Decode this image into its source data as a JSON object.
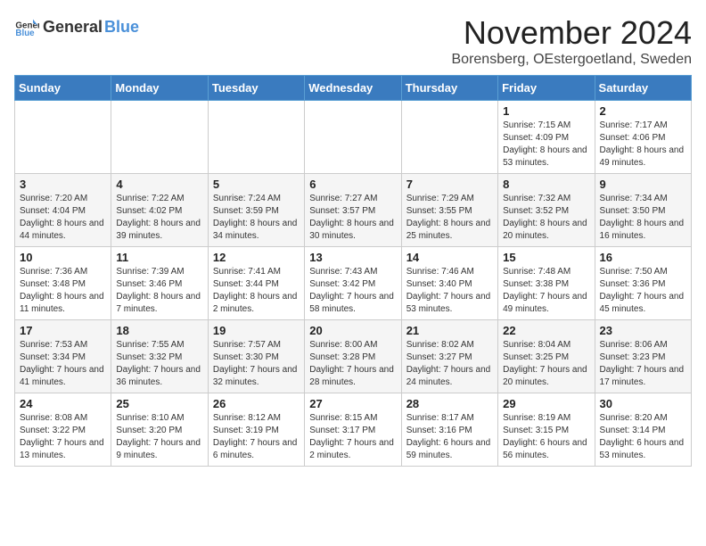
{
  "header": {
    "logo": {
      "text_general": "General",
      "text_blue": "Blue"
    },
    "title": "November 2024",
    "subtitle": "Borensberg, OEstergoetland, Sweden"
  },
  "calendar": {
    "weekdays": [
      "Sunday",
      "Monday",
      "Tuesday",
      "Wednesday",
      "Thursday",
      "Friday",
      "Saturday"
    ],
    "weeks": [
      [
        {
          "day": "",
          "info": ""
        },
        {
          "day": "",
          "info": ""
        },
        {
          "day": "",
          "info": ""
        },
        {
          "day": "",
          "info": ""
        },
        {
          "day": "",
          "info": ""
        },
        {
          "day": "1",
          "info": "Sunrise: 7:15 AM\nSunset: 4:09 PM\nDaylight: 8 hours and 53 minutes."
        },
        {
          "day": "2",
          "info": "Sunrise: 7:17 AM\nSunset: 4:06 PM\nDaylight: 8 hours and 49 minutes."
        }
      ],
      [
        {
          "day": "3",
          "info": "Sunrise: 7:20 AM\nSunset: 4:04 PM\nDaylight: 8 hours and 44 minutes."
        },
        {
          "day": "4",
          "info": "Sunrise: 7:22 AM\nSunset: 4:02 PM\nDaylight: 8 hours and 39 minutes."
        },
        {
          "day": "5",
          "info": "Sunrise: 7:24 AM\nSunset: 3:59 PM\nDaylight: 8 hours and 34 minutes."
        },
        {
          "day": "6",
          "info": "Sunrise: 7:27 AM\nSunset: 3:57 PM\nDaylight: 8 hours and 30 minutes."
        },
        {
          "day": "7",
          "info": "Sunrise: 7:29 AM\nSunset: 3:55 PM\nDaylight: 8 hours and 25 minutes."
        },
        {
          "day": "8",
          "info": "Sunrise: 7:32 AM\nSunset: 3:52 PM\nDaylight: 8 hours and 20 minutes."
        },
        {
          "day": "9",
          "info": "Sunrise: 7:34 AM\nSunset: 3:50 PM\nDaylight: 8 hours and 16 minutes."
        }
      ],
      [
        {
          "day": "10",
          "info": "Sunrise: 7:36 AM\nSunset: 3:48 PM\nDaylight: 8 hours and 11 minutes."
        },
        {
          "day": "11",
          "info": "Sunrise: 7:39 AM\nSunset: 3:46 PM\nDaylight: 8 hours and 7 minutes."
        },
        {
          "day": "12",
          "info": "Sunrise: 7:41 AM\nSunset: 3:44 PM\nDaylight: 8 hours and 2 minutes."
        },
        {
          "day": "13",
          "info": "Sunrise: 7:43 AM\nSunset: 3:42 PM\nDaylight: 7 hours and 58 minutes."
        },
        {
          "day": "14",
          "info": "Sunrise: 7:46 AM\nSunset: 3:40 PM\nDaylight: 7 hours and 53 minutes."
        },
        {
          "day": "15",
          "info": "Sunrise: 7:48 AM\nSunset: 3:38 PM\nDaylight: 7 hours and 49 minutes."
        },
        {
          "day": "16",
          "info": "Sunrise: 7:50 AM\nSunset: 3:36 PM\nDaylight: 7 hours and 45 minutes."
        }
      ],
      [
        {
          "day": "17",
          "info": "Sunrise: 7:53 AM\nSunset: 3:34 PM\nDaylight: 7 hours and 41 minutes."
        },
        {
          "day": "18",
          "info": "Sunrise: 7:55 AM\nSunset: 3:32 PM\nDaylight: 7 hours and 36 minutes."
        },
        {
          "day": "19",
          "info": "Sunrise: 7:57 AM\nSunset: 3:30 PM\nDaylight: 7 hours and 32 minutes."
        },
        {
          "day": "20",
          "info": "Sunrise: 8:00 AM\nSunset: 3:28 PM\nDaylight: 7 hours and 28 minutes."
        },
        {
          "day": "21",
          "info": "Sunrise: 8:02 AM\nSunset: 3:27 PM\nDaylight: 7 hours and 24 minutes."
        },
        {
          "day": "22",
          "info": "Sunrise: 8:04 AM\nSunset: 3:25 PM\nDaylight: 7 hours and 20 minutes."
        },
        {
          "day": "23",
          "info": "Sunrise: 8:06 AM\nSunset: 3:23 PM\nDaylight: 7 hours and 17 minutes."
        }
      ],
      [
        {
          "day": "24",
          "info": "Sunrise: 8:08 AM\nSunset: 3:22 PM\nDaylight: 7 hours and 13 minutes."
        },
        {
          "day": "25",
          "info": "Sunrise: 8:10 AM\nSunset: 3:20 PM\nDaylight: 7 hours and 9 minutes."
        },
        {
          "day": "26",
          "info": "Sunrise: 8:12 AM\nSunset: 3:19 PM\nDaylight: 7 hours and 6 minutes."
        },
        {
          "day": "27",
          "info": "Sunrise: 8:15 AM\nSunset: 3:17 PM\nDaylight: 7 hours and 2 minutes."
        },
        {
          "day": "28",
          "info": "Sunrise: 8:17 AM\nSunset: 3:16 PM\nDaylight: 6 hours and 59 minutes."
        },
        {
          "day": "29",
          "info": "Sunrise: 8:19 AM\nSunset: 3:15 PM\nDaylight: 6 hours and 56 minutes."
        },
        {
          "day": "30",
          "info": "Sunrise: 8:20 AM\nSunset: 3:14 PM\nDaylight: 6 hours and 53 minutes."
        }
      ]
    ]
  }
}
